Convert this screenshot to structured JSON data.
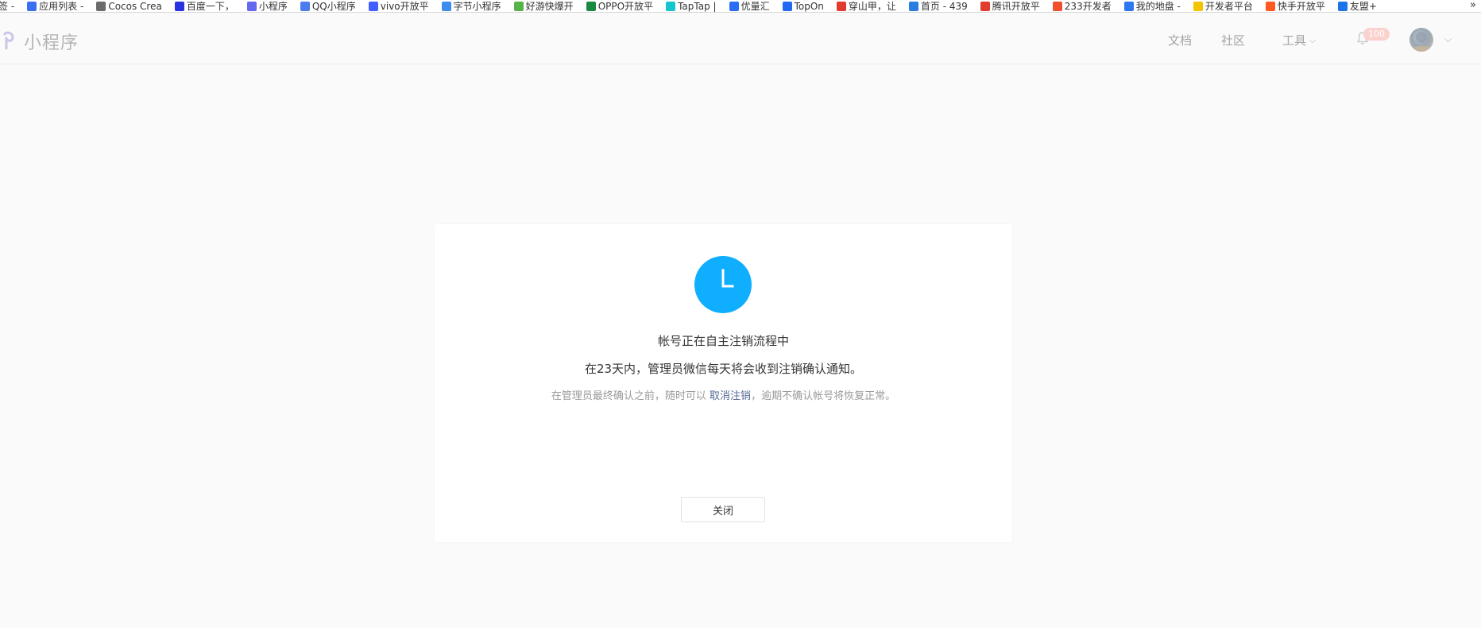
{
  "bookmarks": {
    "items": [
      {
        "label": "应用列表 -",
        "icon": "app-list-icon",
        "color": "#3a6ff2"
      },
      {
        "label": "Cocos Crea",
        "icon": "document-icon",
        "color": "#6c6c6c"
      },
      {
        "label": "百度一下，",
        "icon": "baidu-paw-icon",
        "color": "#2932e1"
      },
      {
        "label": "小程序",
        "icon": "mini-program-icon",
        "color": "#6467f0"
      },
      {
        "label": "QQ小程序",
        "icon": "qq-mini-icon",
        "color": "#4b7bec"
      },
      {
        "label": "vivo开放平",
        "icon": "vivo-icon",
        "color": "#415fff"
      },
      {
        "label": "字节小程序",
        "icon": "bytedance-icon",
        "color": "#3c8cf0"
      },
      {
        "label": "好游快爆开",
        "icon": "haoyou-icon",
        "color": "#56b34a"
      },
      {
        "label": "OPPO开放平",
        "icon": "oppo-icon",
        "color": "#1a8a43"
      },
      {
        "label": "TapTap |",
        "icon": "taptap-icon",
        "color": "#15c5ce"
      },
      {
        "label": "优量汇",
        "icon": "youlianghui-icon",
        "color": "#2b6cf6"
      },
      {
        "label": "TopOn",
        "icon": "topon-icon",
        "color": "#2469f6"
      },
      {
        "label": "穿山甲，让",
        "icon": "pangle-icon",
        "color": "#e13b2f"
      },
      {
        "label": "首页 - 439",
        "icon": "home-439-icon",
        "color": "#2a7de1"
      },
      {
        "label": "腾讯开放平",
        "icon": "tencent-open-icon",
        "color": "#e03d2f"
      },
      {
        "label": "233开发者",
        "icon": "233-icon",
        "color": "#f0502c"
      },
      {
        "label": "我的地盘 -",
        "icon": "my-space-icon",
        "color": "#2d77f0"
      },
      {
        "label": "开发者平台",
        "icon": "dev-platform-icon",
        "color": "#f5c400"
      },
      {
        "label": "快手开放平",
        "icon": "kuaishou-icon",
        "color": "#ff5a1f"
      },
      {
        "label": "友盟+",
        "icon": "umeng-icon",
        "color": "#1a73e8"
      }
    ],
    "more": "»",
    "first_fragment": "签 -"
  },
  "header": {
    "logo_text": "小程序",
    "nav": {
      "docs": "文档",
      "community": "社区",
      "tools": "工具"
    },
    "notification_count": "100",
    "colors": {
      "logo": "#b5b5b5",
      "nav": "#a5a5a5",
      "badge": "#fbd1cd"
    }
  },
  "dialog": {
    "title": "帐号正在自主注销流程中",
    "description": "在23天内，管理员微信每天将会收到注销确认通知。",
    "tip_before": "在管理员最终确认之前，随时可以 ",
    "tip_link": "取消注销",
    "tip_after": "，逾期不确认帐号将恢复正常。",
    "close_label": "关闭",
    "status_icon": "clock-icon",
    "colors": {
      "status_icon": "#10aeff",
      "link": "#576b95"
    }
  }
}
